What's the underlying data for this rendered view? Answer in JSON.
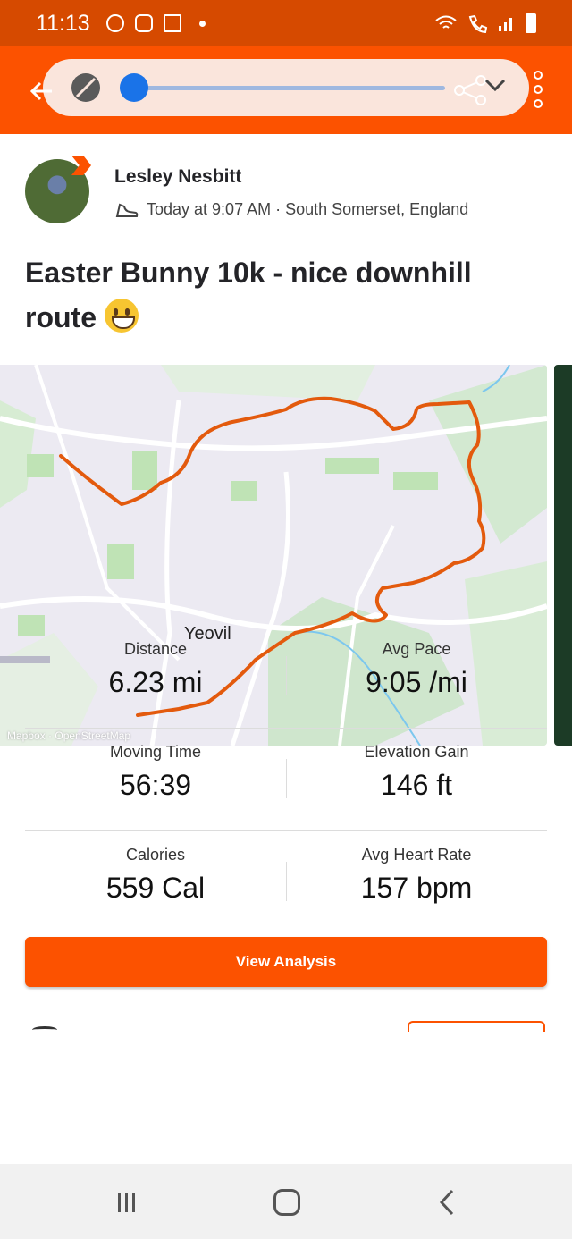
{
  "status_bar": {
    "time": "11:13",
    "icons": [
      "whatsapp-icon",
      "snapchat-icon",
      "mail-icon",
      "dot-icon",
      "wifi-icon",
      "call-icon",
      "signal-icon",
      "battery-icon"
    ]
  },
  "app_bar": {
    "icons": [
      "back-arrow-icon",
      "mute-icon",
      "share-icon",
      "chevron-down-icon",
      "more-vertical-icon"
    ],
    "accent": "#fc5200"
  },
  "activity": {
    "athlete_name": "Lesley Nesbitt",
    "meta": "Today at 9:07 AM · South Somerset, England",
    "title": "Easter Bunny 10k - nice downhill route",
    "map": {
      "place_label": "Yeovil",
      "credit": "Mapbox · OpenStreetMap"
    },
    "stats": [
      {
        "label": "Distance",
        "value": "6.23 mi"
      },
      {
        "label": "Avg Pace",
        "value": "9:05 /mi"
      },
      {
        "label": "Moving Time",
        "value": "56:39"
      },
      {
        "label": "Elevation Gain",
        "value": "146 ft"
      },
      {
        "label": "Calories",
        "value": "559 Cal"
      },
      {
        "label": "Avg Heart Rate",
        "value": "157 bpm"
      }
    ],
    "view_analysis_label": "View Analysis"
  },
  "nav_bar": {
    "icons": [
      "recent-apps-icon",
      "home-icon",
      "back-icon"
    ]
  }
}
